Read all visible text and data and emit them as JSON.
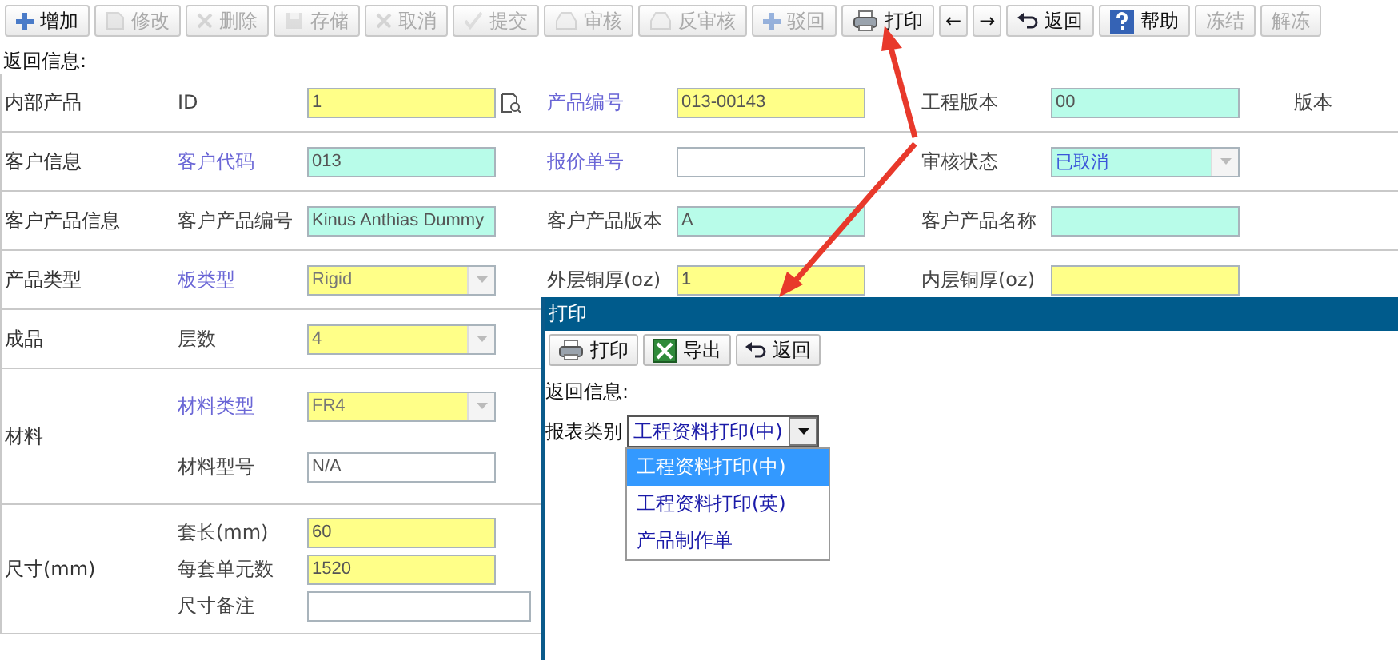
{
  "toolbar": [
    {
      "label": "增加",
      "kind": "add",
      "disabled": false
    },
    {
      "label": "修改",
      "kind": "edit",
      "disabled": true
    },
    {
      "label": "删除",
      "kind": "delete",
      "disabled": true
    },
    {
      "label": "存储",
      "kind": "save",
      "disabled": true
    },
    {
      "label": "取消",
      "kind": "delete",
      "disabled": true
    },
    {
      "label": "提交",
      "kind": "check",
      "disabled": true
    },
    {
      "label": "审核",
      "kind": "tray",
      "disabled": true
    },
    {
      "label": "反审核",
      "kind": "tray",
      "disabled": true
    },
    {
      "label": "驳回",
      "kind": "add",
      "disabled": true
    },
    {
      "label": "打印",
      "kind": "print",
      "disabled": false
    },
    {
      "label": "←",
      "kind": "glyph",
      "disabled": false
    },
    {
      "label": "→",
      "kind": "glyph",
      "disabled": false
    },
    {
      "label": "返回",
      "kind": "back",
      "disabled": false
    },
    {
      "label": "帮助",
      "kind": "help",
      "disabled": false
    },
    {
      "label": "冻结",
      "kind": "plain",
      "disabled": true
    },
    {
      "label": "解冻",
      "kind": "plain",
      "disabled": true
    }
  ],
  "message_label": "返回信息:",
  "groups": [
    {
      "label": "内部产品",
      "lines": [
        [
          {
            "label": "ID",
            "link": false,
            "kind": "lookup",
            "value": "1",
            "color": "#ffff88"
          },
          {
            "label": "产品编号",
            "link": true,
            "kind": "input",
            "value": "013-00143",
            "color": "#ffff88"
          },
          {
            "label": "工程版本",
            "link": false,
            "kind": "input",
            "value": "00",
            "color": "#b8fce9"
          },
          {
            "label": "版本",
            "link": false,
            "kind": "label"
          }
        ]
      ]
    },
    {
      "label": "客户信息",
      "lines": [
        [
          {
            "label": "客户代码",
            "link": true,
            "kind": "input",
            "value": "013",
            "color": "#b8fce9"
          },
          {
            "label": "报价单号",
            "link": true,
            "kind": "input",
            "color": "#ffffff"
          },
          {
            "label": "审核状态",
            "link": false,
            "kind": "select",
            "value": "已取消",
            "color": "#b8fce9"
          }
        ]
      ]
    },
    {
      "label": "客户产品信息",
      "lines": [
        [
          {
            "label": "客户产品编号",
            "link": false,
            "kind": "input",
            "value": "Kinus Anthias Dummy",
            "color": "#b8fce9"
          },
          {
            "label": "客户产品版本",
            "link": false,
            "kind": "input",
            "value": "A",
            "color": "#b8fce9"
          },
          {
            "label": "客户产品名称",
            "link": false,
            "kind": "input",
            "color": "#b8fce9"
          }
        ]
      ]
    },
    {
      "label": "产品类型",
      "lines": [
        [
          {
            "label": "板类型",
            "link": true,
            "kind": "select",
            "value": "Rigid",
            "color": "#ffff88"
          },
          {
            "label": "外层铜厚(oz)",
            "link": false,
            "kind": "input",
            "value": "1",
            "color": "#ffff88"
          },
          {
            "label": "内层铜厚(oz)",
            "link": false,
            "kind": "input",
            "color": "#ffff88"
          }
        ]
      ]
    },
    {
      "label": "成品",
      "lines": [
        [
          {
            "label": "层数",
            "link": false,
            "kind": "select",
            "value": "4",
            "color": "#ffff88"
          }
        ]
      ]
    },
    {
      "label": "材料",
      "lines": [
        [
          {
            "label": "材料类型",
            "link": true,
            "kind": "select",
            "value": "FR4",
            "color": "#ffff88"
          }
        ],
        [
          {
            "label": "材料型号",
            "link": false,
            "kind": "input",
            "value": "N/A",
            "color": "#ffffff"
          }
        ]
      ]
    },
    {
      "label": "尺寸(mm)",
      "lines": [
        [
          {
            "label": "套长(mm)",
            "link": false,
            "kind": "input",
            "value": "60",
            "color": "#ffff88"
          }
        ],
        [
          {
            "label": "每套单元数",
            "link": false,
            "kind": "input",
            "value": "1520",
            "color": "#ffff88"
          }
        ],
        [
          {
            "label": "尺寸备注",
            "link": false,
            "kind": "wide",
            "color": "#ffffff"
          }
        ]
      ]
    }
  ],
  "dialog": {
    "title": "打印",
    "buttons": [
      {
        "label": "打印",
        "kind": "print"
      },
      {
        "label": "导出",
        "kind": "excel"
      },
      {
        "label": "返回",
        "kind": "back"
      }
    ],
    "message_label": "返回信息:",
    "report_label": "报表类别",
    "report_value": "工程资料打印(中)",
    "options": [
      {
        "label": "工程资料打印(中)",
        "selected": true
      },
      {
        "label": "工程资料打印(英)",
        "selected": false
      },
      {
        "label": "产品制作单",
        "selected": false
      }
    ]
  }
}
